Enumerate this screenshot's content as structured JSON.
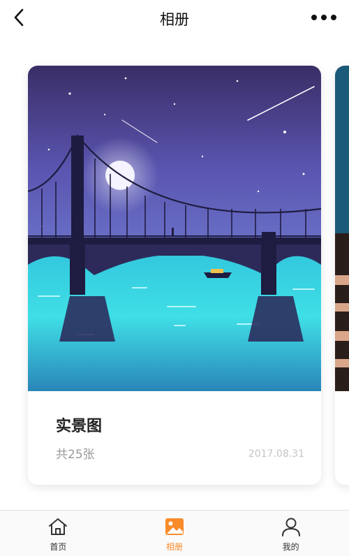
{
  "header": {
    "title": "相册",
    "back_icon": "chevron-left-icon",
    "more_icon": "more-dots-icon"
  },
  "album": {
    "title": "实景图",
    "count": "共25张",
    "date": "2017.08.31",
    "image_description_icon": "night-bridge-illustration"
  },
  "tabs": [
    {
      "label": "首页",
      "icon": "home-icon",
      "active": false
    },
    {
      "label": "相册",
      "icon": "album-icon",
      "active": true
    },
    {
      "label": "我的",
      "icon": "user-icon",
      "active": false
    }
  ],
  "colors": {
    "accent": "#f98b2a",
    "sky_top": "#3a2d66",
    "water": "#3ad7e6"
  }
}
